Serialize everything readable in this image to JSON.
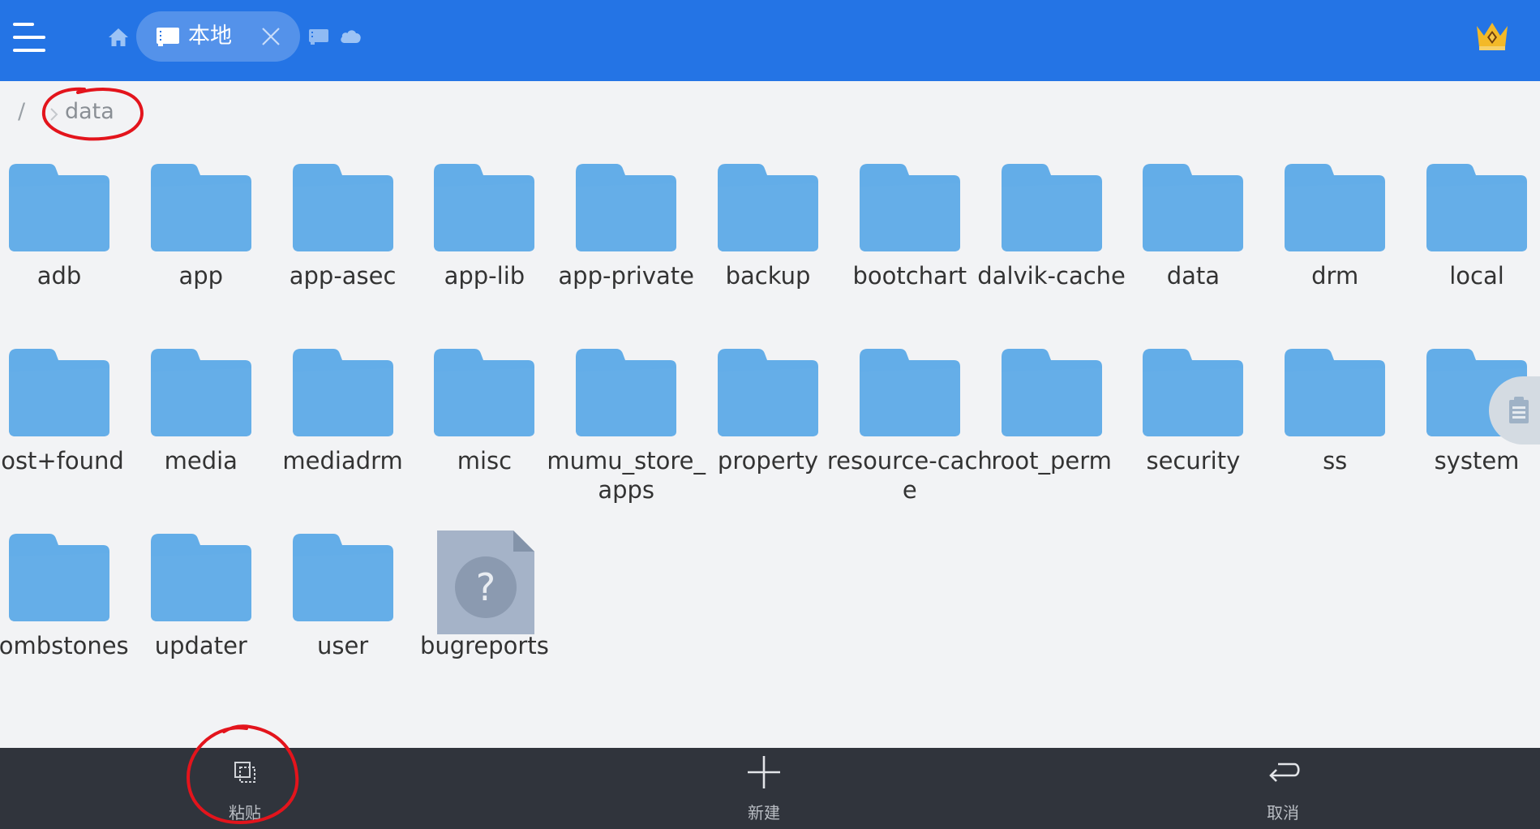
{
  "header": {
    "tab_label": "本地",
    "accent": "#2474e5"
  },
  "breadcrumb": {
    "root": "/",
    "current": "data"
  },
  "items": [
    {
      "name": "adb",
      "type": "folder"
    },
    {
      "name": "app",
      "type": "folder"
    },
    {
      "name": "app-asec",
      "type": "folder"
    },
    {
      "name": "app-lib",
      "type": "folder"
    },
    {
      "name": "app-private",
      "type": "folder"
    },
    {
      "name": "backup",
      "type": "folder"
    },
    {
      "name": "bootchart",
      "type": "folder"
    },
    {
      "name": "dalvik-cache",
      "type": "folder"
    },
    {
      "name": "data",
      "type": "folder"
    },
    {
      "name": "drm",
      "type": "folder"
    },
    {
      "name": "local",
      "type": "folder"
    },
    {
      "name": "lost+found",
      "type": "folder"
    },
    {
      "name": "media",
      "type": "folder"
    },
    {
      "name": "mediadrm",
      "type": "folder"
    },
    {
      "name": "misc",
      "type": "folder"
    },
    {
      "name": "mumu_store_apps",
      "type": "folder"
    },
    {
      "name": "property",
      "type": "folder"
    },
    {
      "name": "resource-cache",
      "type": "folder"
    },
    {
      "name": "root_perm",
      "type": "folder"
    },
    {
      "name": "security",
      "type": "folder"
    },
    {
      "name": "ss",
      "type": "folder"
    },
    {
      "name": "system",
      "type": "folder"
    },
    {
      "name": "tombstones",
      "type": "folder"
    },
    {
      "name": "updater",
      "type": "folder"
    },
    {
      "name": "user",
      "type": "folder"
    },
    {
      "name": "bugreports",
      "type": "unknown-file"
    }
  ],
  "bottom_bar": {
    "paste_label": "粘贴",
    "new_label": "新建",
    "cancel_label": "取消"
  }
}
